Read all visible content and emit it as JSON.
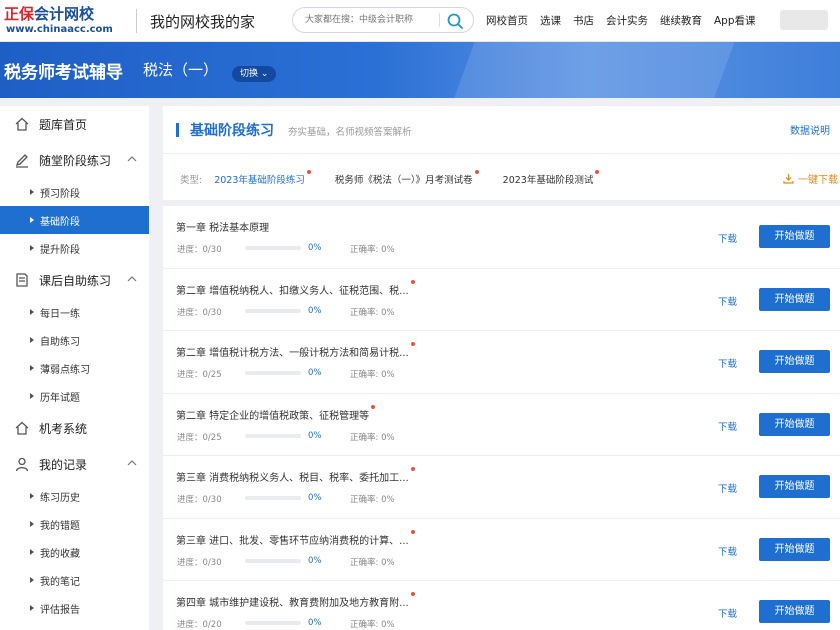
{
  "header": {
    "logo_brand_a": "正保",
    "logo_brand_b": "会计网校",
    "logo_url": "www.chinaacc.com",
    "slogan": "我的网校我的家",
    "search_placeholder": "大家都在搜：中级会计职称",
    "nav": [
      "网校首页",
      "选课",
      "书店",
      "会计实务",
      "继续教育",
      "App看课"
    ]
  },
  "banner": {
    "title": "税务师考试辅导",
    "subject": "税法（一）",
    "switch_label": "切换 ⌄"
  },
  "sidebar": {
    "sections": [
      {
        "label": "题库首页",
        "icon": "house-icon",
        "items": []
      },
      {
        "label": "随堂阶段练习",
        "icon": "pen-icon",
        "items": [
          "预习阶段",
          "基础阶段",
          "提升阶段"
        ]
      },
      {
        "label": "课后自助练习",
        "icon": "book-icon",
        "items": [
          "每日一练",
          "自助练习",
          "薄弱点练习",
          "历年试题"
        ]
      },
      {
        "label": "机考系统",
        "icon": "house-icon",
        "items": []
      },
      {
        "label": "我的记录",
        "icon": "user-icon",
        "items": [
          "练习历史",
          "我的错题",
          "我的收藏",
          "我的笔记",
          "评估报告"
        ]
      }
    ],
    "active_item": "基础阶段"
  },
  "main": {
    "title": "基础阶段练习",
    "subtitle": "夯实基础，名师视频答案解析",
    "data_explain": "数据说明",
    "type_label": "类型:",
    "types": [
      "2023年基础阶段练习",
      "税务师《税法（一）》月考测试卷",
      "2023年基础阶段测试"
    ],
    "download_all": "一键下载",
    "row_labels": {
      "progress": "进度：",
      "accuracy": "正确率: ",
      "download": "下载",
      "start": "开始做题"
    },
    "rows": [
      {
        "name": "第一章 税法基本原理",
        "progress": "0/30",
        "percent": "0%",
        "accuracy": "0%",
        "dot": false
      },
      {
        "name": "第二章 增值税纳税人、扣缴义务人、征税范围、税...",
        "progress": "0/30",
        "percent": "0%",
        "accuracy": "0%",
        "dot": true
      },
      {
        "name": "第二章 增值税计税方法、一般计税方法和简易计税...",
        "progress": "0/25",
        "percent": "0%",
        "accuracy": "0%",
        "dot": true
      },
      {
        "name": "第二章 特定企业的增值税政策、征税管理等",
        "progress": "0/25",
        "percent": "0%",
        "accuracy": "0%",
        "dot": true
      },
      {
        "name": "第三章 消费税纳税义务人、税目、税率、委托加工...",
        "progress": "0/30",
        "percent": "0%",
        "accuracy": "0%",
        "dot": true
      },
      {
        "name": "第三章 进口、批发、零售环节应纳消费税的计算、...",
        "progress": "0/30",
        "percent": "0%",
        "accuracy": "0%",
        "dot": true
      },
      {
        "name": "第四章 城市维护建设税、教育费附加及地方教育附...",
        "progress": "0/20",
        "percent": "0%",
        "accuracy": "0%",
        "dot": true
      }
    ]
  },
  "colors": {
    "primary": "#1f6fd1",
    "accent_orange": "#e8891c",
    "dot_red": "#e8533a"
  }
}
